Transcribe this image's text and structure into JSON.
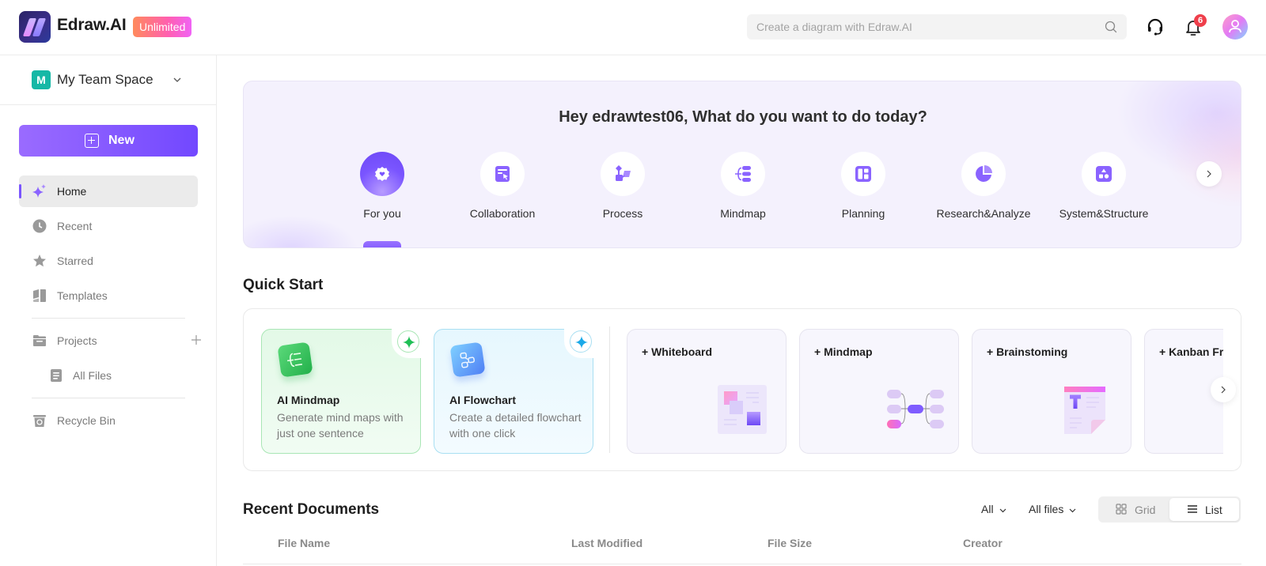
{
  "header": {
    "brand": "Edraw.AI",
    "plan_badge": "Unlimited",
    "search_placeholder": "Create a diagram with Edraw.AI",
    "notification_count": "6",
    "icons": {
      "support": "headset-icon",
      "notifications": "bell-icon",
      "search": "search-icon",
      "avatar": "user-avatar"
    }
  },
  "sidebar": {
    "team_initial": "M",
    "team_name": "My Team Space",
    "new_button": "New",
    "items": [
      {
        "label": "Home",
        "icon": "sparkle-icon",
        "active": true
      },
      {
        "label": "Recent",
        "icon": "clock-icon"
      },
      {
        "label": "Starred",
        "icon": "star-icon"
      },
      {
        "label": "Templates",
        "icon": "templates-icon"
      },
      {
        "label": "Projects",
        "icon": "folder-icon"
      },
      {
        "label": "All Files",
        "icon": "files-icon"
      },
      {
        "label": "Recycle Bin",
        "icon": "trash-icon"
      }
    ],
    "colors": {
      "accent": "#7a55ff",
      "team_badge": "#17b8a6"
    }
  },
  "hero": {
    "greeting": "Hey edrawtest06, What do you want to do today?",
    "categories": [
      {
        "label": "For you",
        "icon": "for-you-icon",
        "active": true
      },
      {
        "label": "Collaboration",
        "icon": "collaboration-icon"
      },
      {
        "label": "Process",
        "icon": "process-icon"
      },
      {
        "label": "Mindmap",
        "icon": "mindmap-icon"
      },
      {
        "label": "Planning",
        "icon": "planning-icon"
      },
      {
        "label": "Research&Analyze",
        "icon": "pie-chart-icon"
      },
      {
        "label": "System&Structure",
        "icon": "shapes-icon"
      }
    ]
  },
  "quick_start": {
    "title": "Quick Start",
    "ai_cards": [
      {
        "title": "AI Mindmap",
        "description": "Generate mind maps with just one sentence",
        "accent": "#22b04a"
      },
      {
        "title": "AI Flowchart",
        "description": "Create a detailed flowchart with one click",
        "accent": "#1aa9e8"
      }
    ],
    "templates": [
      {
        "title": "+ Whiteboard"
      },
      {
        "title": "+ Mindmap"
      },
      {
        "title": "+ Brainstoming"
      },
      {
        "title": "+ Kanban Fr"
      }
    ]
  },
  "recent_documents": {
    "title": "Recent Documents",
    "filter_type": "All",
    "filter_files": "All files",
    "view_grid": "Grid",
    "view_list": "List",
    "selected_view": "List",
    "columns": [
      "File Name",
      "Last Modified",
      "File Size",
      "Creator"
    ]
  }
}
